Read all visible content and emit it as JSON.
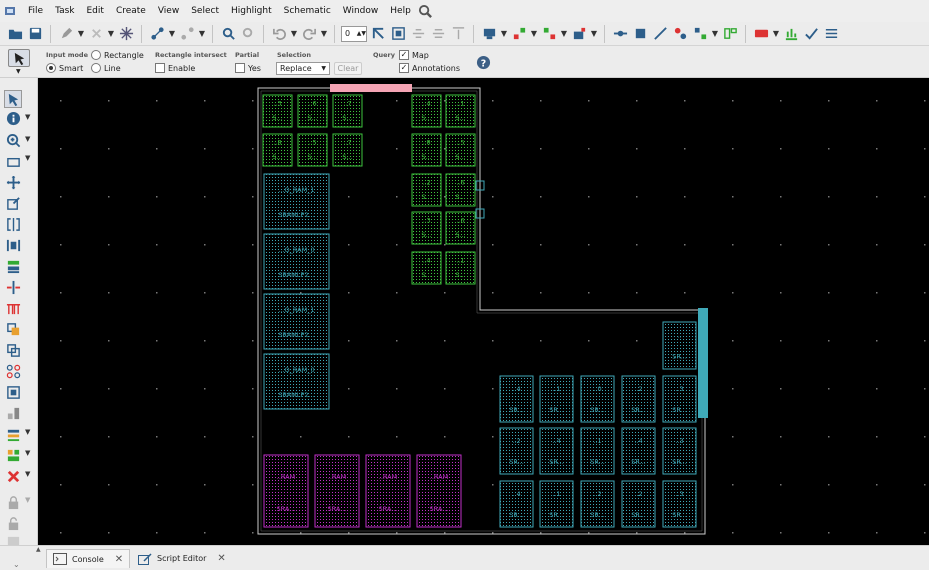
{
  "menu": {
    "items": [
      "File",
      "Task",
      "Edit",
      "Create",
      "View",
      "Select",
      "Highlight",
      "Schematic",
      "Window",
      "Help"
    ]
  },
  "toolbar": {
    "zoom_value": "0"
  },
  "options": {
    "input_mode_label": "Input mode",
    "smart_label": "Smart",
    "rectangle_label": "Rectangle",
    "line_label": "Line",
    "rect_intersect_label": "Rectangle intersect",
    "enable_label": "Enable",
    "partial_label": "Partial",
    "yes_label": "Yes",
    "selection_label": "Selection",
    "selection_value": "Replace",
    "clear_label": "Clear",
    "query_label": "Query",
    "map_label": "Map",
    "annotations_label": "Annotations"
  },
  "bottom_tabs": {
    "console": "Console",
    "script_editor": "Script Editor"
  },
  "layout": {
    "green_row1": [
      "..3",
      "..6",
      "..7",
      "..4",
      "..1"
    ],
    "green_row2": [
      "..8",
      "..5",
      "..7",
      "..8",
      "..5"
    ],
    "green_col_right": [
      "..2",
      "..6",
      "..3",
      "..6",
      "..4",
      "..1"
    ],
    "green_sub": "S...",
    "sram_blocks": [
      {
        "top": "...O_RAM_1",
        "bottom": "SRAMLP2..."
      },
      {
        "top": "...O_RAM_0",
        "bottom": "SRAMLP2..."
      },
      {
        "top": "...O_RAM_1",
        "bottom": "SRAMLP2..."
      },
      {
        "top": "...O_RAM_0",
        "bottom": "SRAMLP2..."
      }
    ],
    "magenta_blocks": [
      {
        "top": "..RAM",
        "bottom": "SRA..."
      },
      {
        "top": "..RAM",
        "bottom": "SRA..."
      },
      {
        "top": "..RAM",
        "bottom": "SRA..."
      },
      {
        "top": "..RAM",
        "bottom": "SRA..."
      }
    ],
    "cyan_single": {
      "top": "..",
      "bottom": "SR..."
    },
    "cyan_row1": [
      "..4",
      "..1",
      "..0",
      "..2",
      "..3"
    ],
    "cyan_row2": [
      "..2",
      "..4",
      "..1",
      "..4",
      "..3"
    ],
    "cyan_row3": [
      "..4",
      "..1",
      "..2",
      "..2",
      "..3"
    ],
    "cyan_sub": "SR..."
  },
  "colors": {
    "green": "#3ec43e",
    "cyan": "#3fa9b8",
    "magenta": "#c030c8",
    "highlight_bar": "#f4a4b4",
    "canvas": "#000000"
  }
}
